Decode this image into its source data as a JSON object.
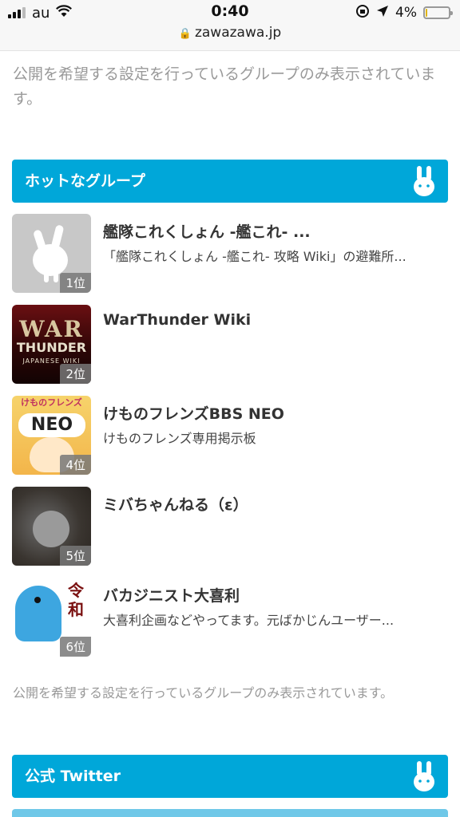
{
  "status_bar": {
    "carrier": "au",
    "time": "0:40",
    "battery_percent": "4%",
    "battery_level": 0.04,
    "url": "zawazawa.jp"
  },
  "top_notice": "公開を希望する設定を行っているグループのみ表示されています。",
  "hot_section": {
    "title": "ホットなグループ",
    "groups": [
      {
        "name": "艦隊これくしょん -艦これ- ...",
        "description": "「艦隊これくしょん -艦これ- 攻略 Wiki」の避難所...",
        "rank": "1位"
      },
      {
        "name": "WarThunder Wiki",
        "description": "",
        "rank": "2位",
        "thumb_text": [
          "WAR",
          "THUNDER",
          "JAPANESE WIKI"
        ]
      },
      {
        "name": "けものフレンズBBS NEO",
        "description": "けものフレンズ専用掲示板",
        "rank": "4位",
        "thumb_text": [
          "けものフレンズBBS",
          "NEO"
        ]
      },
      {
        "name": "ミバちゃんねる（ε）",
        "description": "",
        "rank": "5位"
      },
      {
        "name": "バカジニスト大喜利",
        "description": "大喜利企画などやってます。元ばかじんユーザー...",
        "rank": "6位",
        "thumb_text": [
          "令",
          "和"
        ]
      }
    ]
  },
  "bottom_notice": "公開を希望する設定を行っているグループのみ表示されています。",
  "twitter_section": {
    "title": "公式 Twitter"
  },
  "colors": {
    "accent": "#00a7d9",
    "notice_text": "#999999"
  }
}
